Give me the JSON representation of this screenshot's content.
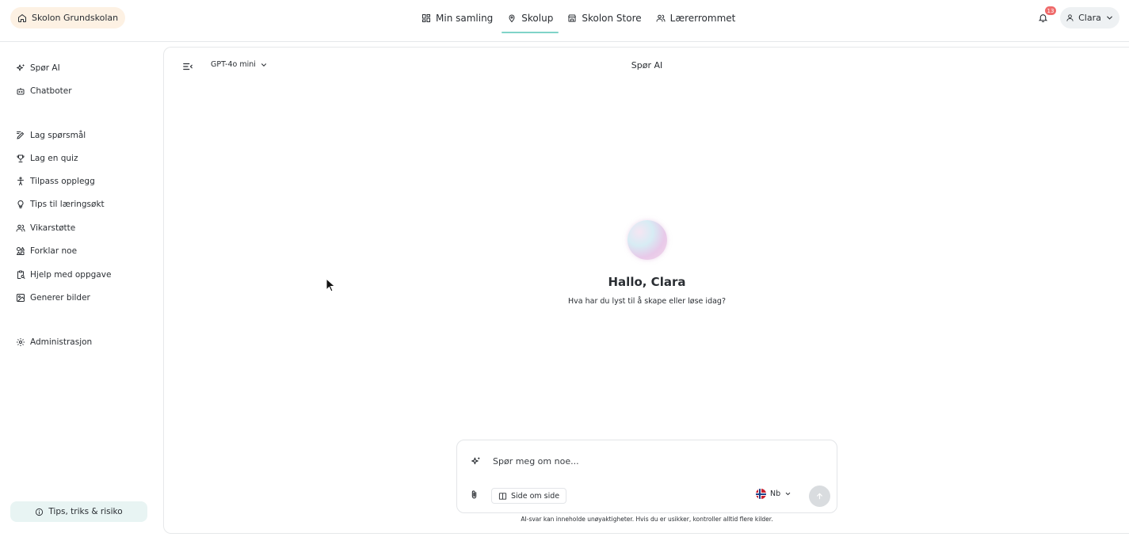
{
  "header": {
    "school": "Skolon Grundskolan",
    "nav": [
      {
        "label": "Min samling",
        "icon": "grid-icon",
        "active": false
      },
      {
        "label": "Skolup",
        "icon": "map-pin-icon",
        "active": true
      },
      {
        "label": "Skolon Store",
        "icon": "store-icon",
        "active": false
      },
      {
        "label": "Lærerrommet",
        "icon": "users-icon",
        "active": false
      }
    ],
    "notification_count": "13",
    "user_name": "Clara"
  },
  "sidebar": {
    "items": [
      {
        "label": "Spør AI",
        "icon": "sparkles-icon"
      },
      {
        "label": "Chatboter",
        "icon": "bot-icon"
      },
      {
        "label": "Lag spørsmål",
        "icon": "pencil-lines-icon"
      },
      {
        "label": "Lag en quiz",
        "icon": "trophy-icon"
      },
      {
        "label": "Tilpass opplegg",
        "icon": "person-icon"
      },
      {
        "label": "Tips til læringsøkt",
        "icon": "lightbulb-icon"
      },
      {
        "label": "Vikarstøtte",
        "icon": "users-icon"
      },
      {
        "label": "Forklar noe",
        "icon": "shapes-icon"
      },
      {
        "label": "Hjelp med oppgave",
        "icon": "clipboard-search-icon"
      },
      {
        "label": "Generer bilder",
        "icon": "image-icon"
      },
      {
        "label": "Administrasjon",
        "icon": "gear-icon"
      }
    ],
    "tips_button": "Tips, triks & risiko"
  },
  "main": {
    "model": "GPT-4o mini",
    "title": "Spør AI",
    "greeting": "Hallo, Clara",
    "subtitle": "Hva har du lyst til å skape eller løse idag?",
    "composer": {
      "placeholder": "Spør meg om noe...",
      "side_by_side": "Side om side",
      "language": "Nb"
    },
    "disclaimer": "AI-svar kan inneholde unøyaktigheter. Hvis du er usikker, kontroller alltid flere kilder."
  },
  "colors": {
    "accent": "#7fd3c8",
    "school_pill_bg": "#fdf1e3",
    "badge": "#ef6b6b"
  }
}
